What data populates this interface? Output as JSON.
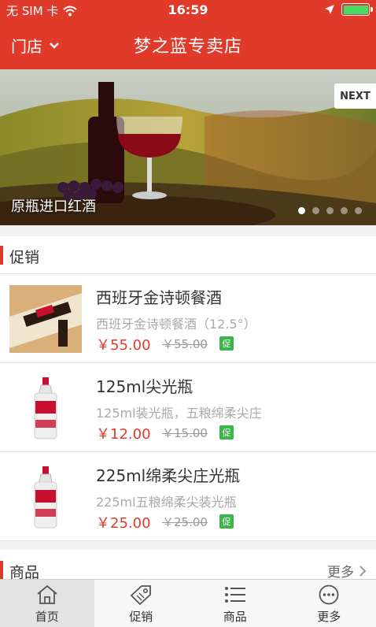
{
  "status_bar": {
    "carrier": "无 SIM 卡",
    "time": "16:59"
  },
  "navbar": {
    "store_label": "门店",
    "title": "梦之蓝专卖店"
  },
  "banner": {
    "next_label": "NEXT",
    "caption": "原瓶进口红酒",
    "slide_count": 5,
    "active_slide": 0
  },
  "promo_section": {
    "title": "促销",
    "items": [
      {
        "name": "西班牙金诗顿餐酒",
        "desc": "西班牙金诗顿餐酒（12.5°）",
        "price": "￥55.00",
        "orig_price": "￥55.00",
        "badge": "促",
        "thumb": "wine-bottle-image"
      },
      {
        "name": "125ml尖光瓶",
        "desc": "125ml装光瓶，五粮绵柔尖庄",
        "price": "￥12.00",
        "orig_price": "￥15.00",
        "badge": "促",
        "thumb": "baijiu-bottle-image"
      },
      {
        "name": "225ml绵柔尖庄光瓶",
        "desc": "225ml五粮绵柔尖装光瓶",
        "price": "￥25.00",
        "orig_price": "￥25.00",
        "badge": "促",
        "thumb": "baijiu-bottle-image"
      }
    ]
  },
  "goods_section": {
    "title": "商品",
    "more_label": "更多"
  },
  "tabbar": {
    "tabs": [
      {
        "label": "首页",
        "icon": "home-icon",
        "active": true
      },
      {
        "label": "促销",
        "icon": "tag-icon",
        "active": false
      },
      {
        "label": "商品",
        "icon": "list-icon",
        "active": false
      },
      {
        "label": "更多",
        "icon": "more-icon",
        "active": false
      }
    ]
  },
  "colors": {
    "brand_red": "#e03a2b",
    "promo_green": "#3cb54a",
    "battery_green": "#4cd964"
  }
}
